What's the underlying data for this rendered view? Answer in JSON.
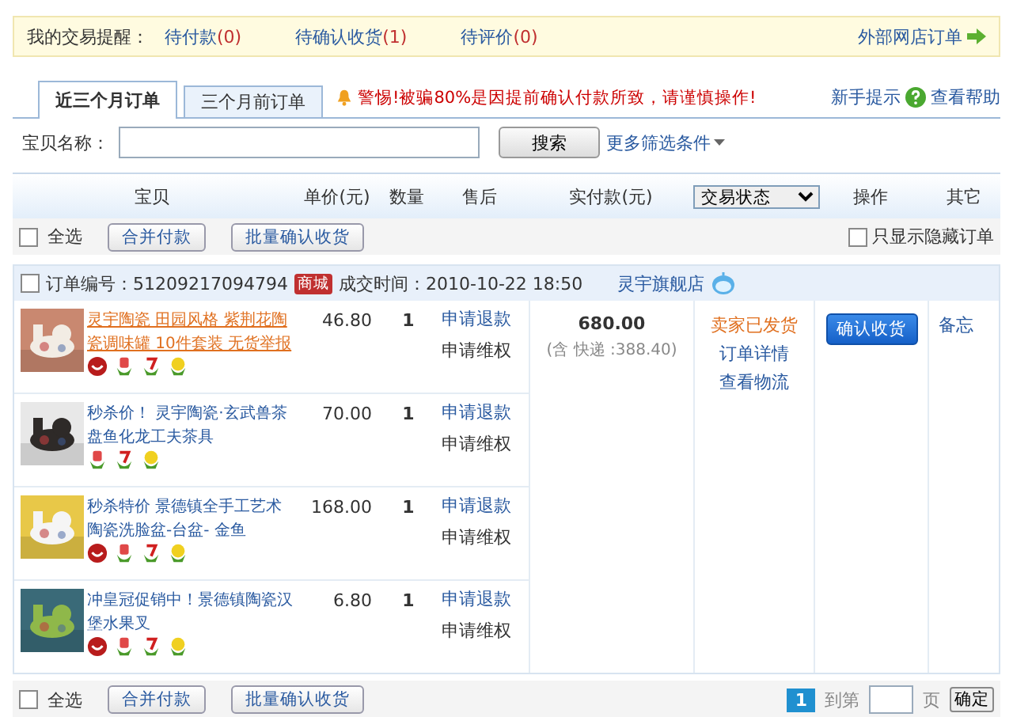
{
  "reminder": {
    "label": "我的交易提醒：",
    "links": [
      {
        "text": "待付款",
        "count": "(0)"
      },
      {
        "text": "待确认收货",
        "count": "(1)"
      },
      {
        "text": "待评价",
        "count": "(0)"
      }
    ],
    "external": "外部网店订单"
  },
  "tabs": [
    {
      "label": "近三个月订单",
      "selected": true
    },
    {
      "label": "三个月前订单",
      "selected": false
    }
  ],
  "warning": "警惕!被骗80%是因提前确认付款所致，请谨慎操作!",
  "help": {
    "tip": "新手提示",
    "link": "查看帮助"
  },
  "search": {
    "label": "宝贝名称：",
    "button": "搜索",
    "more": "更多筛选条件"
  },
  "columns": [
    "宝贝",
    "单价(元)",
    "数量",
    "售后",
    "实付款(元)",
    "交易状态",
    "操作",
    "其它"
  ],
  "actions": {
    "select_all": "全选",
    "checked": false,
    "merge": "合并付款",
    "batch": "批量确认收货",
    "hidden_only": "只显示隐藏订单",
    "hidden_checked": false
  },
  "order": {
    "checked": false,
    "number_label": "订单编号：",
    "number": "51209217094794",
    "mall_badge": "商城",
    "time_label": "成交时间：",
    "time": "2010-10-22 18:50",
    "shop": "灵宇旗舰店",
    "total": "680.00",
    "shipping": "(含 快递 :388.40)",
    "status": "卖家已发货",
    "detail": "订单详情",
    "logistics": "查看物流",
    "confirm": "确认收货",
    "memo": "备忘",
    "items": [
      {
        "title": "灵宇陶瓷 田园风格 紫荆花陶瓷调味罐 10件套装 无货举报",
        "highlighted": true,
        "badges": [
          {
            "kind": "chat"
          },
          {
            "kind": "genuine"
          },
          {
            "kind": "seven"
          },
          {
            "kind": "flower"
          }
        ],
        "price": "46.80",
        "qty": "1",
        "refund": "申请退款",
        "protect": "申请维权"
      },
      {
        "title": "秒杀价！ 灵宇陶瓷·玄武兽茶盘鱼化龙工夫茶具",
        "highlighted": false,
        "badges": [
          {
            "kind": "genuine"
          },
          {
            "kind": "seven"
          },
          {
            "kind": "flower"
          }
        ],
        "price": "70.00",
        "qty": "1",
        "refund": "申请退款",
        "protect": "申请维权"
      },
      {
        "title": "秒杀特价 景德镇全手工艺术陶瓷洗脸盆-台盆- 金鱼",
        "highlighted": false,
        "badges": [
          {
            "kind": "chat"
          },
          {
            "kind": "genuine"
          },
          {
            "kind": "seven"
          },
          {
            "kind": "flower"
          }
        ],
        "price": "168.00",
        "qty": "1",
        "refund": "申请退款",
        "protect": "申请维权"
      },
      {
        "title": "冲皇冠促销中！景德镇陶瓷汉堡水果叉",
        "highlighted": false,
        "badges": [
          {
            "kind": "chat"
          },
          {
            "kind": "genuine"
          },
          {
            "kind": "seven"
          },
          {
            "kind": "flower"
          }
        ],
        "price": "6.80",
        "qty": "1",
        "refund": "申请退款",
        "protect": "申请维权"
      }
    ]
  },
  "footer": {
    "select_all": "全选",
    "checked": false,
    "merge": "合并付款",
    "batch": "批量确认收货",
    "pages": [
      {
        "label": "1",
        "selected": true
      }
    ],
    "goto": "到第",
    "unit": "页",
    "ok": "确定"
  }
}
